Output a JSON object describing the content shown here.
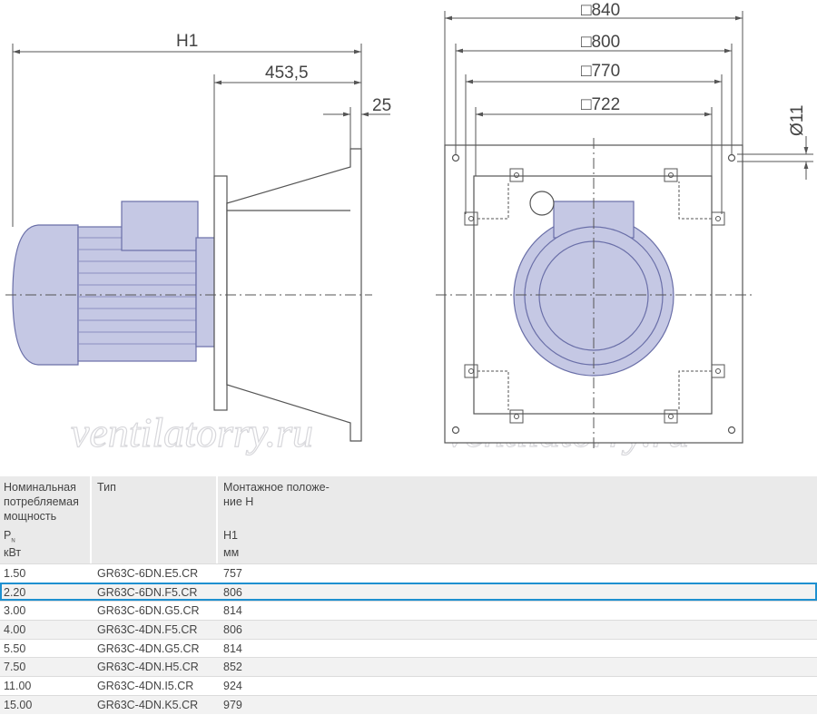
{
  "drawing": {
    "dimensions": {
      "h1": "H1",
      "d453": "453,5",
      "d25": "25",
      "sq840": "□840",
      "sq800": "□800",
      "sq770": "□770",
      "sq722": "□722",
      "hole": "Ø11"
    },
    "watermark": "ventilatorry.ru",
    "colors": {
      "motor": "#c5c8e4",
      "motor_stroke": "#6a6fa8",
      "lines": "#555555"
    }
  },
  "table": {
    "headers": {
      "col1_lines": [
        "Номинальная",
        "потребляемая",
        "мощность"
      ],
      "col1_symbol": "P",
      "col1_symbol_sub": "N",
      "col1_unit": "кВт",
      "col2": "Тип",
      "col3_lines": [
        "Монтажное положе-",
        "ние H"
      ],
      "col3_symbol": "H1",
      "col3_unit": "мм"
    },
    "rows": [
      {
        "power": "1.50",
        "type": "GR63C-6DN.E5.CR",
        "h1": "757"
      },
      {
        "power": "2.20",
        "type": "GR63C-6DN.F5.CR",
        "h1": "806"
      },
      {
        "power": "3.00",
        "type": "GR63C-6DN.G5.CR",
        "h1": "814"
      },
      {
        "power": "4.00",
        "type": "GR63C-4DN.F5.CR",
        "h1": "806"
      },
      {
        "power": "5.50",
        "type": "GR63C-4DN.G5.CR",
        "h1": "814"
      },
      {
        "power": "7.50",
        "type": "GR63C-4DN.H5.CR",
        "h1": "852"
      },
      {
        "power": "11.00",
        "type": "GR63C-4DN.I5.CR",
        "h1": "924"
      },
      {
        "power": "15.00",
        "type": "GR63C-4DN.K5.CR",
        "h1": "979"
      }
    ]
  }
}
